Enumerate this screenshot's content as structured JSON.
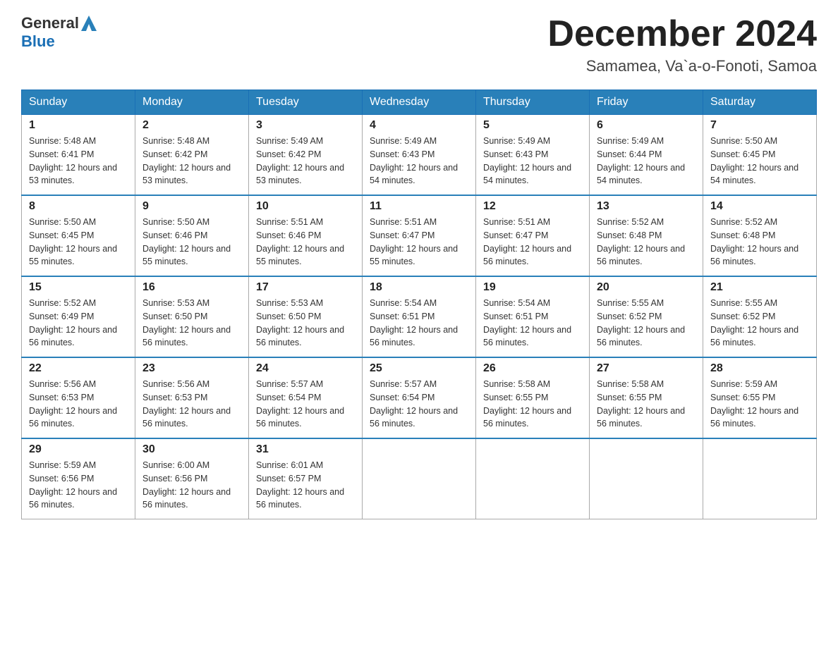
{
  "logo": {
    "text_general": "General",
    "text_blue": "Blue",
    "triangle_symbol": "▶"
  },
  "title": "December 2024",
  "subtitle": "Samamea, Va`a-o-Fonoti, Samoa",
  "headers": [
    "Sunday",
    "Monday",
    "Tuesday",
    "Wednesday",
    "Thursday",
    "Friday",
    "Saturday"
  ],
  "weeks": [
    [
      {
        "day": "1",
        "sunrise": "5:48 AM",
        "sunset": "6:41 PM",
        "daylight": "12 hours and 53 minutes."
      },
      {
        "day": "2",
        "sunrise": "5:48 AM",
        "sunset": "6:42 PM",
        "daylight": "12 hours and 53 minutes."
      },
      {
        "day": "3",
        "sunrise": "5:49 AM",
        "sunset": "6:42 PM",
        "daylight": "12 hours and 53 minutes."
      },
      {
        "day": "4",
        "sunrise": "5:49 AM",
        "sunset": "6:43 PM",
        "daylight": "12 hours and 54 minutes."
      },
      {
        "day": "5",
        "sunrise": "5:49 AM",
        "sunset": "6:43 PM",
        "daylight": "12 hours and 54 minutes."
      },
      {
        "day": "6",
        "sunrise": "5:49 AM",
        "sunset": "6:44 PM",
        "daylight": "12 hours and 54 minutes."
      },
      {
        "day": "7",
        "sunrise": "5:50 AM",
        "sunset": "6:45 PM",
        "daylight": "12 hours and 54 minutes."
      }
    ],
    [
      {
        "day": "8",
        "sunrise": "5:50 AM",
        "sunset": "6:45 PM",
        "daylight": "12 hours and 55 minutes."
      },
      {
        "day": "9",
        "sunrise": "5:50 AM",
        "sunset": "6:46 PM",
        "daylight": "12 hours and 55 minutes."
      },
      {
        "day": "10",
        "sunrise": "5:51 AM",
        "sunset": "6:46 PM",
        "daylight": "12 hours and 55 minutes."
      },
      {
        "day": "11",
        "sunrise": "5:51 AM",
        "sunset": "6:47 PM",
        "daylight": "12 hours and 55 minutes."
      },
      {
        "day": "12",
        "sunrise": "5:51 AM",
        "sunset": "6:47 PM",
        "daylight": "12 hours and 56 minutes."
      },
      {
        "day": "13",
        "sunrise": "5:52 AM",
        "sunset": "6:48 PM",
        "daylight": "12 hours and 56 minutes."
      },
      {
        "day": "14",
        "sunrise": "5:52 AM",
        "sunset": "6:48 PM",
        "daylight": "12 hours and 56 minutes."
      }
    ],
    [
      {
        "day": "15",
        "sunrise": "5:52 AM",
        "sunset": "6:49 PM",
        "daylight": "12 hours and 56 minutes."
      },
      {
        "day": "16",
        "sunrise": "5:53 AM",
        "sunset": "6:50 PM",
        "daylight": "12 hours and 56 minutes."
      },
      {
        "day": "17",
        "sunrise": "5:53 AM",
        "sunset": "6:50 PM",
        "daylight": "12 hours and 56 minutes."
      },
      {
        "day": "18",
        "sunrise": "5:54 AM",
        "sunset": "6:51 PM",
        "daylight": "12 hours and 56 minutes."
      },
      {
        "day": "19",
        "sunrise": "5:54 AM",
        "sunset": "6:51 PM",
        "daylight": "12 hours and 56 minutes."
      },
      {
        "day": "20",
        "sunrise": "5:55 AM",
        "sunset": "6:52 PM",
        "daylight": "12 hours and 56 minutes."
      },
      {
        "day": "21",
        "sunrise": "5:55 AM",
        "sunset": "6:52 PM",
        "daylight": "12 hours and 56 minutes."
      }
    ],
    [
      {
        "day": "22",
        "sunrise": "5:56 AM",
        "sunset": "6:53 PM",
        "daylight": "12 hours and 56 minutes."
      },
      {
        "day": "23",
        "sunrise": "5:56 AM",
        "sunset": "6:53 PM",
        "daylight": "12 hours and 56 minutes."
      },
      {
        "day": "24",
        "sunrise": "5:57 AM",
        "sunset": "6:54 PM",
        "daylight": "12 hours and 56 minutes."
      },
      {
        "day": "25",
        "sunrise": "5:57 AM",
        "sunset": "6:54 PM",
        "daylight": "12 hours and 56 minutes."
      },
      {
        "day": "26",
        "sunrise": "5:58 AM",
        "sunset": "6:55 PM",
        "daylight": "12 hours and 56 minutes."
      },
      {
        "day": "27",
        "sunrise": "5:58 AM",
        "sunset": "6:55 PM",
        "daylight": "12 hours and 56 minutes."
      },
      {
        "day": "28",
        "sunrise": "5:59 AM",
        "sunset": "6:55 PM",
        "daylight": "12 hours and 56 minutes."
      }
    ],
    [
      {
        "day": "29",
        "sunrise": "5:59 AM",
        "sunset": "6:56 PM",
        "daylight": "12 hours and 56 minutes."
      },
      {
        "day": "30",
        "sunrise": "6:00 AM",
        "sunset": "6:56 PM",
        "daylight": "12 hours and 56 minutes."
      },
      {
        "day": "31",
        "sunrise": "6:01 AM",
        "sunset": "6:57 PM",
        "daylight": "12 hours and 56 minutes."
      },
      null,
      null,
      null,
      null
    ]
  ]
}
